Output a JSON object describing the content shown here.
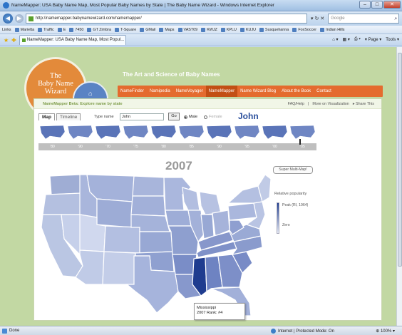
{
  "window": {
    "title": "NameMapper: USA Baby Name Map, Most Popular Baby Names by State | The Baby Name Wizard - Windows Internet Explorer",
    "controls": [
      "–",
      "□",
      "✕"
    ]
  },
  "nav": {
    "url": "http://namemapper.babynamewizard.com/namemapper/",
    "search_placeholder": "Google",
    "refresh": "↻",
    "stop": "✕"
  },
  "links_bar": {
    "label": "Links",
    "items": [
      "Marietta",
      "Traffic",
      "E",
      "7450",
      "GT Zimbra",
      "T-Square",
      "GMail",
      "Maps",
      "VAST09",
      "KWJZ",
      "KPLU",
      "KUJU",
      "Susquehanna",
      "FoxSoccer",
      "Indian Hills"
    ]
  },
  "tab": {
    "label": "NameMapper: USA Baby Name Map, Most Popul..."
  },
  "command_bar": {
    "page": "Page",
    "tools": "Tools"
  },
  "site": {
    "logo_lines": [
      "The",
      "Baby Name",
      "Wizard"
    ],
    "tagline": "The Art and Science of Baby Names",
    "nav_items": [
      "NameFinder",
      "Namipedia",
      "NameVoyager",
      "NameMapper",
      "Name Wizard Blog",
      "About the Book",
      "Contact"
    ]
  },
  "panel": {
    "beta_label": "NameMapper Beta: Explore name by state",
    "links": [
      "FAQ/Help",
      "More on Visualization",
      "Share This"
    ],
    "tabs": [
      "Map",
      "Timeline"
    ],
    "type_name_label": "Type name",
    "name_value": "John",
    "go_label": "Go",
    "male_label": "Male",
    "female_label": "Female",
    "big_name": "John",
    "decades": [
      "'80",
      "'90",
      "'70",
      "'75",
      "'80",
      "'85",
      "'90",
      "'95",
      "'00",
      "'05"
    ],
    "year": "2007",
    "multimap_label": "Super Multi-Map!",
    "legend_title": "Relative popularity",
    "legend_peak": "Peak (RI, 1964)",
    "legend_zero": "Zero",
    "tooltip_state": "Mississippi",
    "tooltip_rank": "2007 Rank: #4"
  },
  "status": {
    "left": "Done",
    "zone": "Internet | Protected Mode: On",
    "zoom": "100%"
  }
}
